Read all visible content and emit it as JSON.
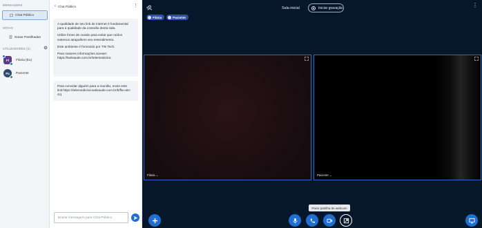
{
  "nav": {
    "messages_heading": "MENSAGENS",
    "public_chat_label": "Chat Público",
    "notes_heading": "NOTAS",
    "shared_notes_label": "Notas Partilhadas",
    "users_heading": "UTILIZADORES (2)",
    "users": [
      {
        "initials": "Fl",
        "name": "Flávia (Eu)"
      },
      {
        "initials": "Pa",
        "name": "Paciente"
      }
    ]
  },
  "chat": {
    "title": "Chat Público",
    "welcome_messages": [
      "A qualidade de seu link de internet é fundamental para a qualidade da conexão desta sala.",
      "Utilize fones de ouvido para evitar que ruídos externos atrapalhem seu entendimento.",
      "Este ambiente é fornecido por TW Tech.",
      "Para maiores informações acesse: https://twtisaude.com.br/telemedicina."
    ],
    "invite_message": "Para convidar alguém para a reunião, envie este link:https://telemedicina.twtisaude.com.br/b/fla-u0n-4cj",
    "input_placeholder": "Enviar mensagem para Chat Público"
  },
  "main": {
    "room_title": "Sala inicial",
    "record_label": "Iniciar gravação",
    "talkers": [
      "Flávia",
      "Paciente"
    ],
    "videos": [
      {
        "name": "Flávia ⌄"
      },
      {
        "name": "Paciente ⌄"
      }
    ],
    "tooltip": "Parar partilha de webcam"
  },
  "colors": {
    "accent": "#1f6fd0",
    "main_bg": "#06172a",
    "talker_pill": "#2f4ea8",
    "video_border": "#3466c4"
  },
  "icons": [
    "users-icon",
    "record-icon",
    "more-icon",
    "expand-icon",
    "plus-icon",
    "mic-icon",
    "phone-icon",
    "camera-icon",
    "share-video-icon",
    "desktop-icon",
    "send-icon",
    "chat-icon",
    "notes-icon",
    "back-chevron-icon",
    "gear-icon"
  ]
}
